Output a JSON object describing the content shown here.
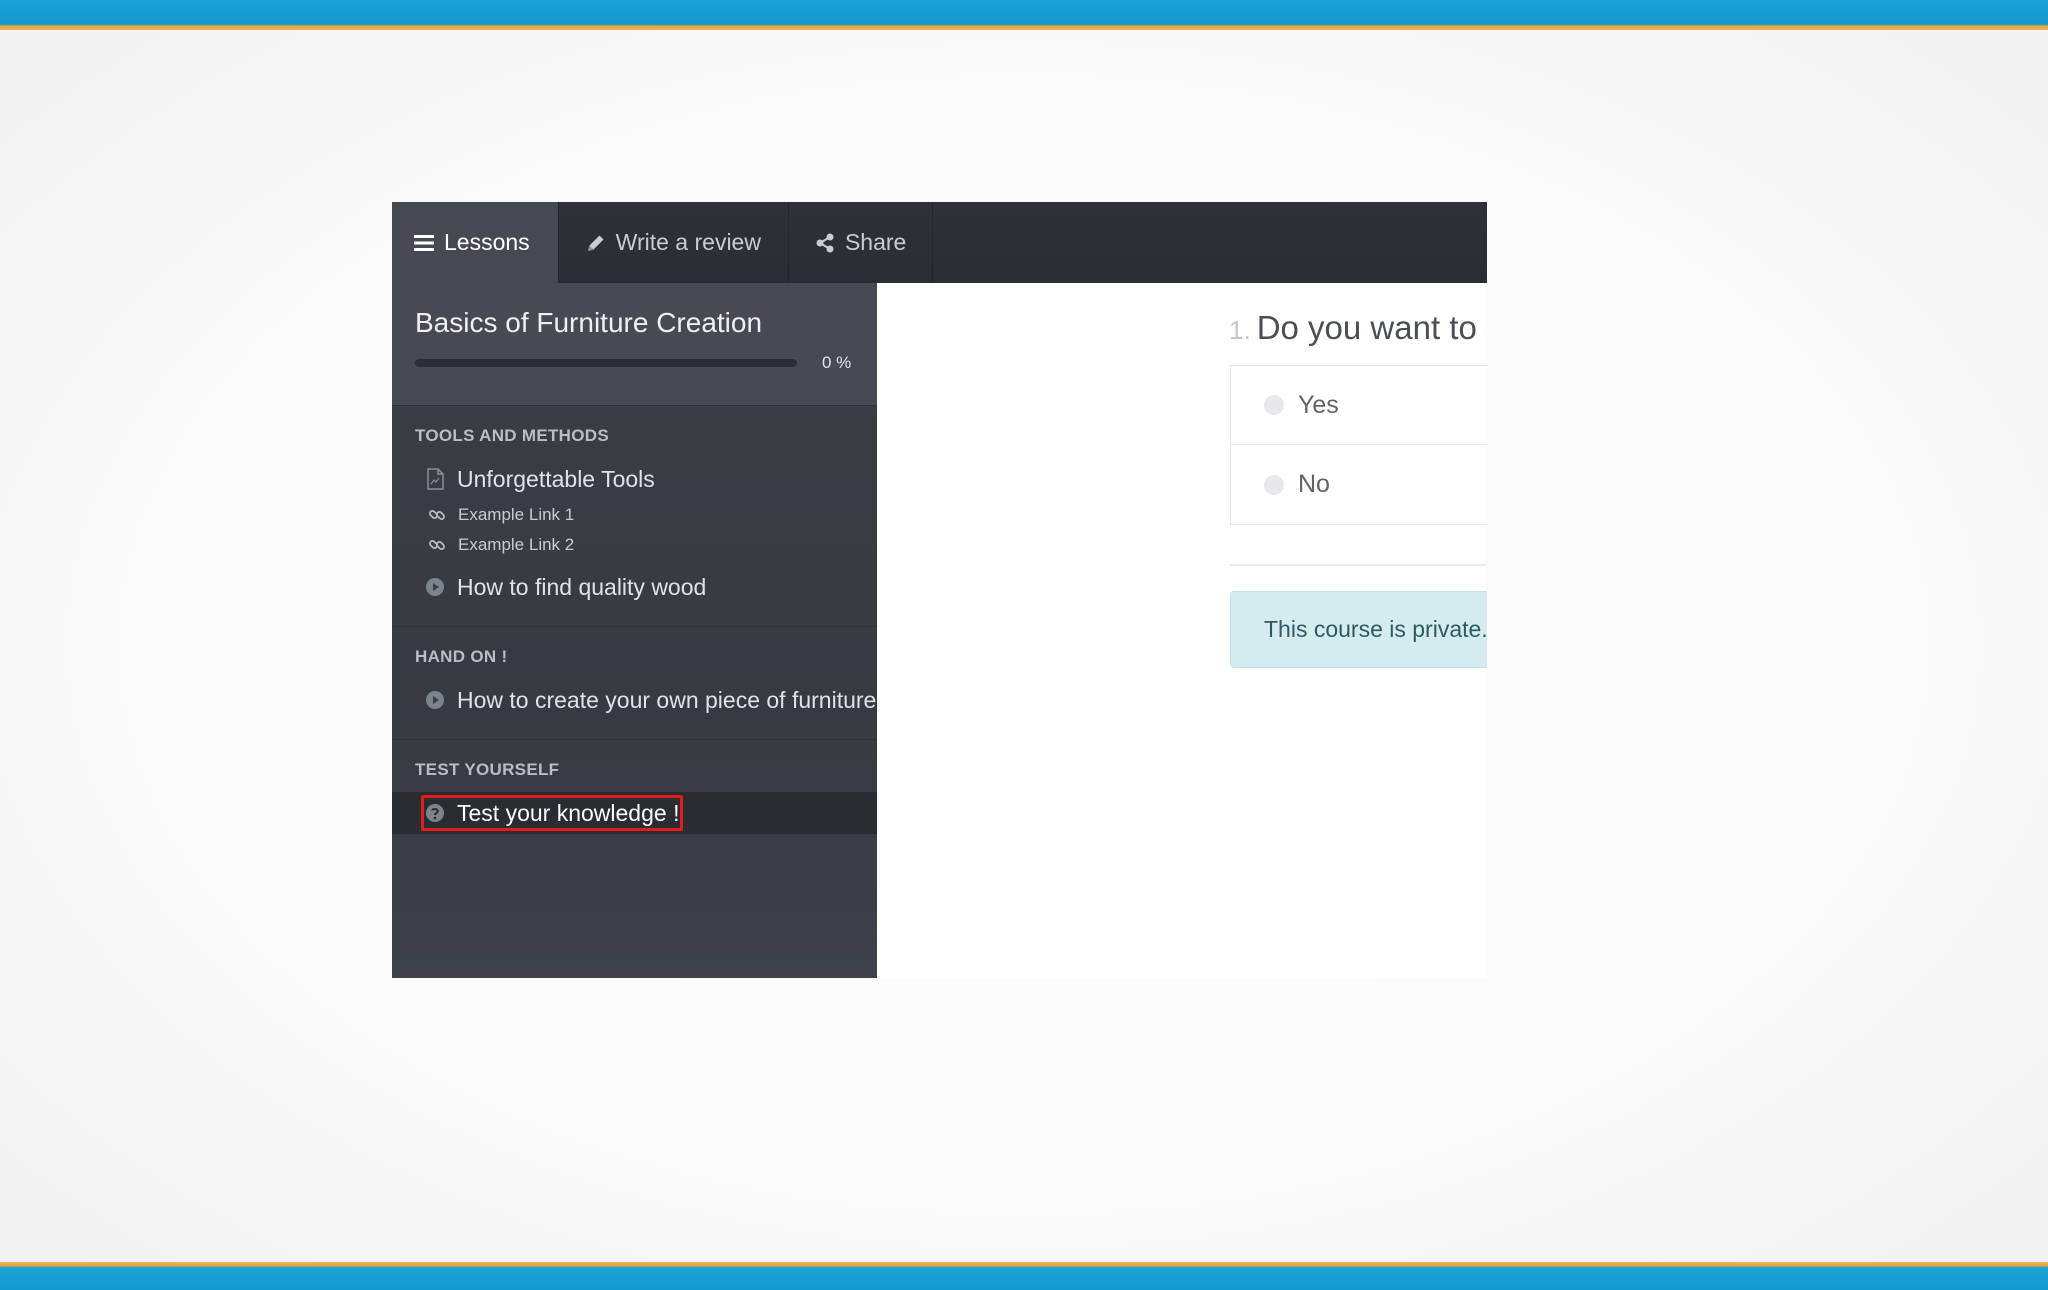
{
  "colors": {
    "accent": "#1499cc",
    "highlight": "#e21b1b",
    "alert_bg": "#d4ecef"
  },
  "toolbar": {
    "tabs": [
      {
        "label": "Lessons",
        "icon": "menu-icon",
        "active": true
      },
      {
        "label": "Write a review",
        "icon": "pencil-icon",
        "active": false
      },
      {
        "label": "Share",
        "icon": "share-icon",
        "active": false
      }
    ]
  },
  "sidebar": {
    "course_title": "Basics of Furniture Creation",
    "progress_percent": 0,
    "progress_text": "0 %",
    "sections": [
      {
        "title": "TOOLS AND METHODS",
        "lessons": [
          {
            "label": "Unforgettable Tools",
            "icon": "document-icon"
          },
          {
            "label": "Example Link 1",
            "icon": "link-icon"
          },
          {
            "label": "Example Link 2",
            "icon": "link-icon"
          },
          {
            "label": "How to find quality wood",
            "icon": "play-icon"
          }
        ]
      },
      {
        "title": "HAND ON !",
        "lessons": [
          {
            "label": "How to create your own piece of furniture",
            "icon": "play-icon"
          }
        ]
      },
      {
        "title": "TEST YOURSELF",
        "lessons": [
          {
            "label": "Test your knowledge !",
            "icon": "question-icon",
            "selected": true
          }
        ]
      }
    ]
  },
  "main": {
    "question_number": "1.",
    "question_text": "Do you want to",
    "answers": [
      "Yes",
      "No"
    ],
    "alert_text": "This course is private."
  }
}
